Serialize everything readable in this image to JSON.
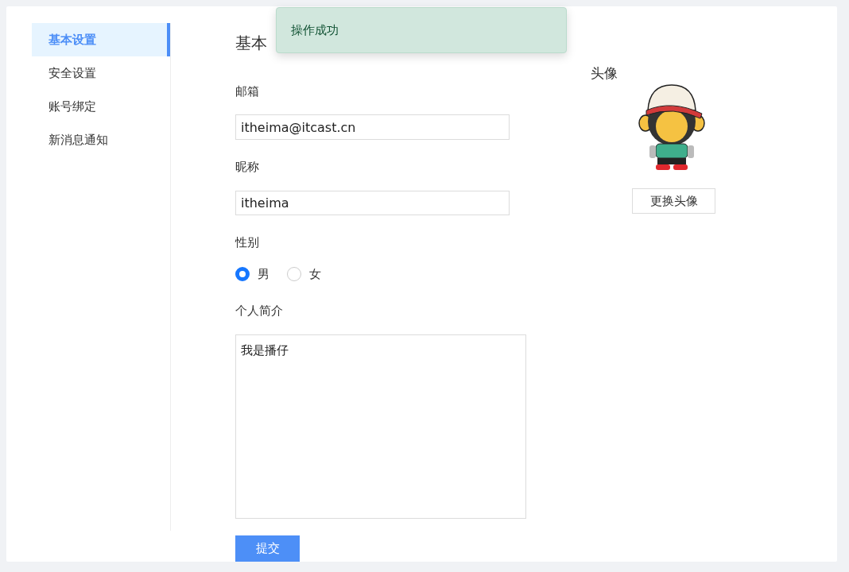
{
  "sidebar": {
    "items": [
      {
        "label": "基本设置",
        "selected": true
      },
      {
        "label": "安全设置",
        "selected": false
      },
      {
        "label": "账号绑定",
        "selected": false
      },
      {
        "label": "新消息通知",
        "selected": false
      }
    ]
  },
  "heading": "基本",
  "form": {
    "email": {
      "label": "邮箱",
      "value": "itheima@itcast.cn"
    },
    "nickname": {
      "label": "昵称",
      "value": "itheima"
    },
    "gender": {
      "label": "性别",
      "options": [
        {
          "label": "男",
          "selected": true
        },
        {
          "label": "女",
          "selected": false
        }
      ]
    },
    "bio": {
      "label": "个人简介",
      "value": "我是播仔"
    },
    "submit": "提交"
  },
  "avatar": {
    "label": "头像",
    "button": "更换头像"
  },
  "toast": {
    "message": "操作成功"
  }
}
